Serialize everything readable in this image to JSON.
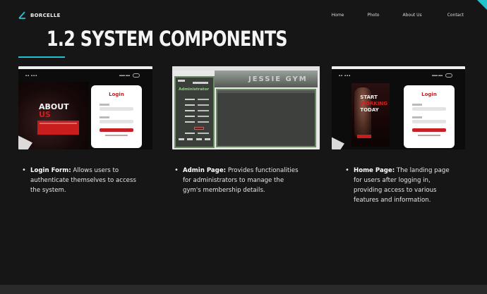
{
  "brand": {
    "name": "BORCELLE"
  },
  "nav": {
    "items": [
      "Home",
      "Photo",
      "About Us",
      "Contact"
    ]
  },
  "slide": {
    "title": "1.2 SYSTEM COMPONENTS"
  },
  "shots": {
    "login": {
      "about_text": "ABOUT",
      "us_text": "US",
      "login_title": "Login"
    },
    "admin": {
      "sidebar_title": "Administrator",
      "banner_text": "JESSIE GYM"
    },
    "home": {
      "line1": "START",
      "line2": "WORKING",
      "line3": "TODAY",
      "login_title": "Login"
    }
  },
  "components": [
    {
      "term": "Login Form:",
      "desc": " Allows users to authenticate themselves to access the system."
    },
    {
      "term": "Admin Page:",
      "desc": " Provides functionalities for administrators to manage the gym's membership details."
    },
    {
      "term": "Home Page:",
      "desc": " The landing page for users after logging in, providing access to various features and information."
    }
  ],
  "colors": {
    "accent": "#22c3cf",
    "brand_red": "#c42026",
    "background": "#161616"
  },
  "icons": {
    "brand_logo": "borcelle-logo-icon",
    "bullet": "bullet-dot-icon"
  }
}
